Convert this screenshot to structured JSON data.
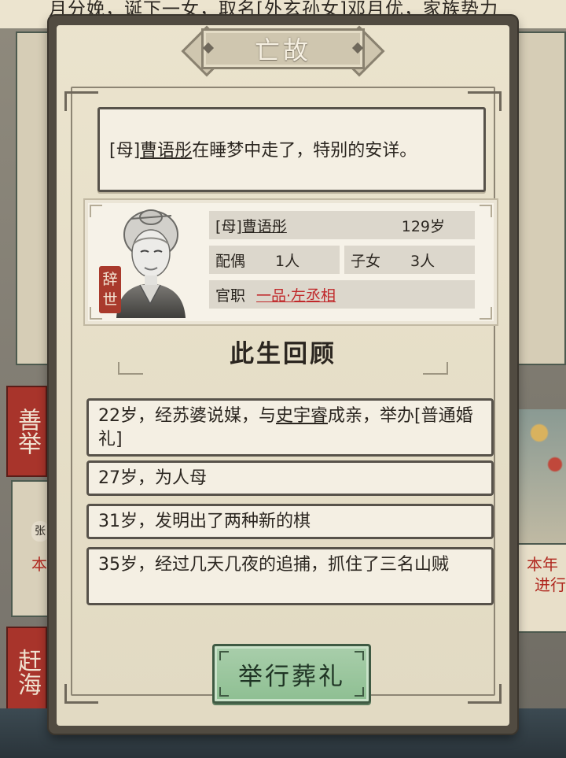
{
  "background": {
    "story_text": "月分娩，诞下一女，取名[外玄孙女]邓月优，家族势力",
    "left_tag_1": "善举",
    "left_tag_2": "赶海",
    "left_tag_3": "本",
    "left_tag_4": "张",
    "right_text_1": "本年",
    "right_text_2": "进行"
  },
  "dialog": {
    "title": "亡故",
    "message": {
      "prefix": "[母]",
      "name": "曹语彤",
      "suffix": "在睡梦中走了，特别的安详。"
    },
    "character": {
      "status_seal": [
        "辞",
        "世"
      ],
      "relation": "[母]",
      "name": "曹语彤",
      "age": "129岁",
      "spouse_label": "配偶",
      "spouse_count": "1人",
      "children_label": "子女",
      "children_count": "3人",
      "office_label": "官职",
      "office_value": "一品·左丞相"
    },
    "review_title": "此生回顾",
    "events": [
      {
        "pre": "22岁，经苏婆说媒，与",
        "link": "史宇睿",
        "post": "成亲，举办[普通婚礼]"
      },
      {
        "pre": "27岁，为人母",
        "link": "",
        "post": ""
      },
      {
        "pre": "31岁，发明出了两种新的棋",
        "link": "",
        "post": ""
      },
      {
        "pre": "35岁，经过几天几夜的追捕，抓住了三名山贼",
        "link": "",
        "post": ""
      }
    ],
    "action_button": "举行葬礼"
  },
  "colors": {
    "accent_red": "#c0282a",
    "button_green": "#8ebf92",
    "modal_frame": "#514b41"
  }
}
